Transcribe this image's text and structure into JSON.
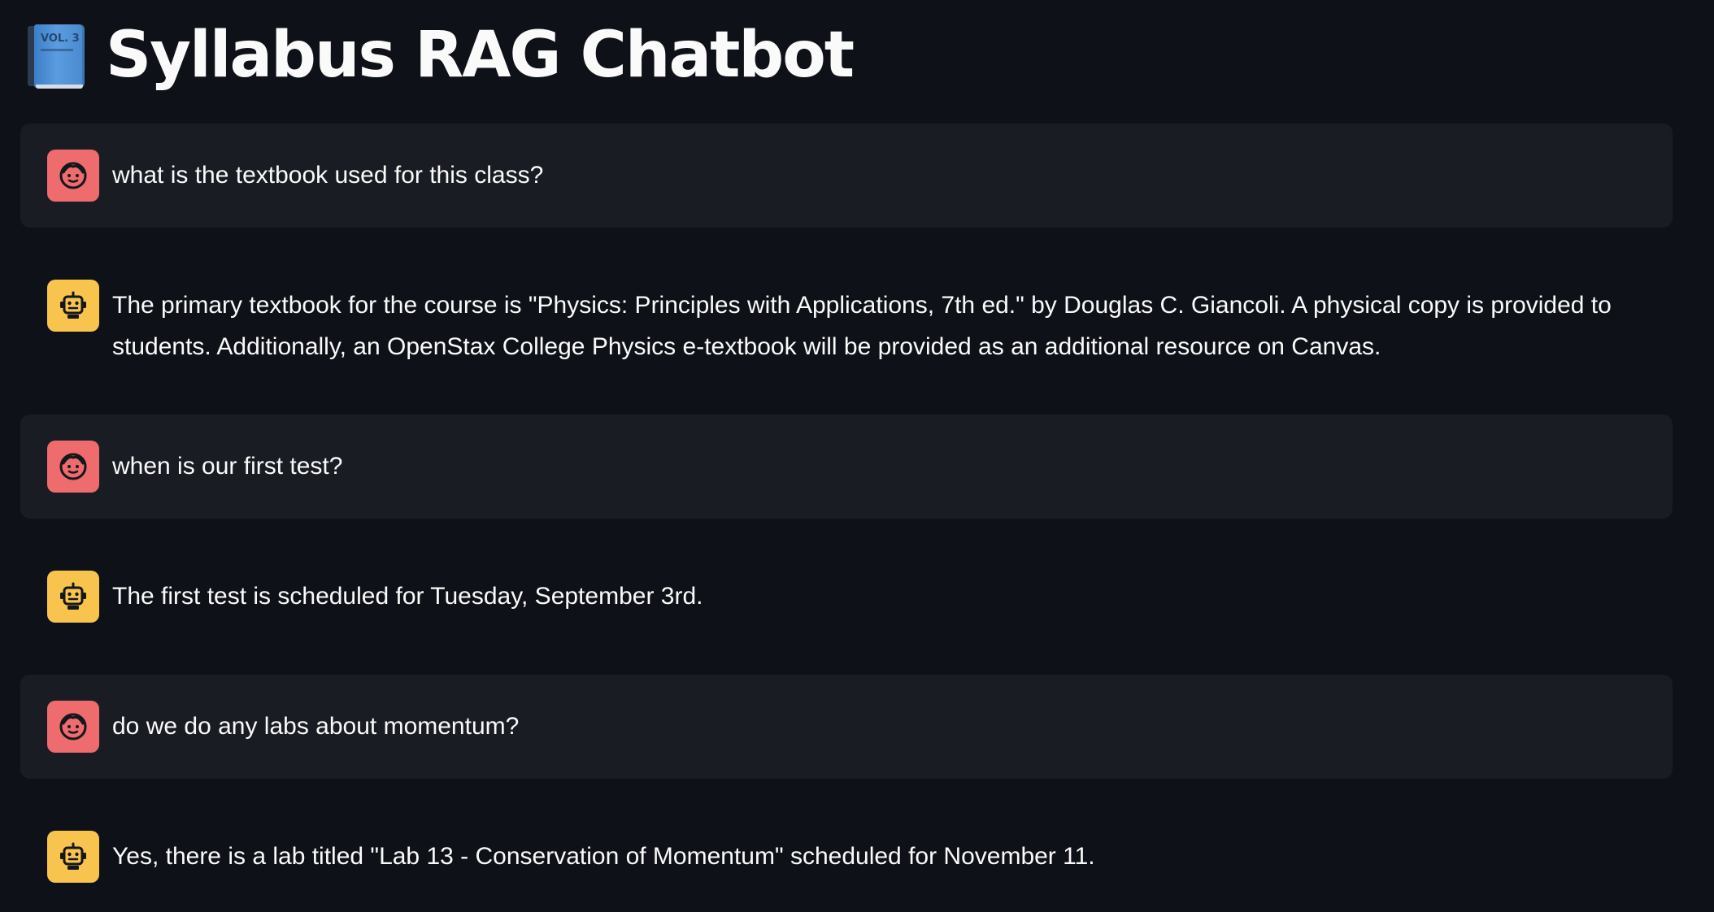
{
  "header": {
    "title": "Syllabus RAG Chatbot",
    "icon": "book-icon",
    "icon_text": "VOL. 3"
  },
  "colors": {
    "background": "#0e1117",
    "user_message_bg": "#1a1c24",
    "user_avatar": "#ee6b6e",
    "assistant_avatar": "#f9c44e",
    "text": "#fafafa"
  },
  "messages": [
    {
      "role": "user",
      "avatar_icon": "user-face-icon",
      "text": "what is the textbook used for this class?"
    },
    {
      "role": "assistant",
      "avatar_icon": "robot-icon",
      "text": "The primary textbook for the course is \"Physics: Principles with Applications, 7th ed.\" by Douglas C. Giancoli. A physical copy is provided to students. Additionally, an OpenStax College Physics e-textbook will be provided as an additional resource on Canvas."
    },
    {
      "role": "user",
      "avatar_icon": "user-face-icon",
      "text": "when is our first test?"
    },
    {
      "role": "assistant",
      "avatar_icon": "robot-icon",
      "text": "The first test is scheduled for Tuesday, September 3rd."
    },
    {
      "role": "user",
      "avatar_icon": "user-face-icon",
      "text": "do we do any labs about momentum?"
    },
    {
      "role": "assistant",
      "avatar_icon": "robot-icon",
      "text": "Yes, there is a lab titled \"Lab 13 - Conservation of Momentum\" scheduled for November 11."
    }
  ]
}
